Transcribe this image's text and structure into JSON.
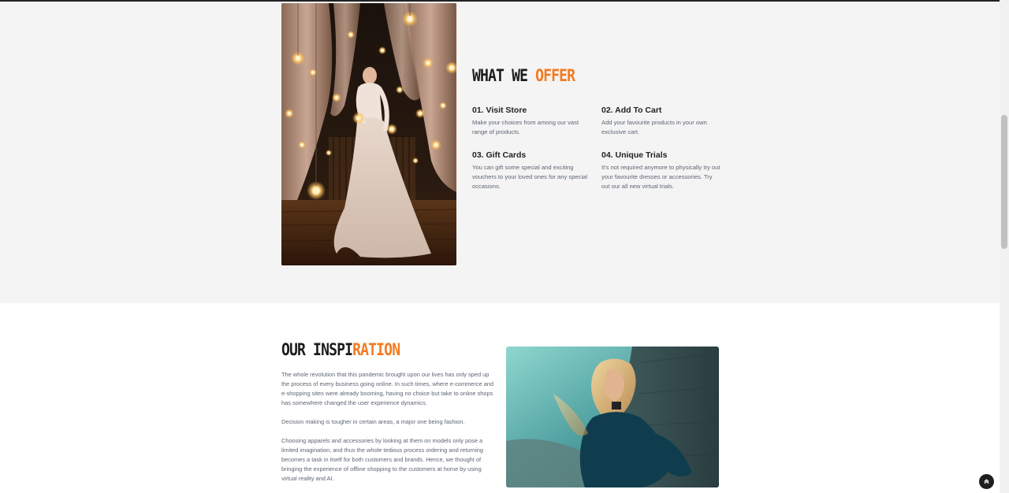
{
  "offer": {
    "title_main": "WHAT WE ",
    "title_accent": "OFFER",
    "items": [
      {
        "title": "01. Visit Store",
        "text": "Make your choices from among our vast range of products."
      },
      {
        "title": "02. Add To Cart",
        "text": "Add your favourite products in your own exclusive cart."
      },
      {
        "title": "03. Gift Cards",
        "text": "You can gift some special and exciting vouchers to your loved ones for any special occasions."
      },
      {
        "title": "04. Unique Trials",
        "text": "It's not required anymore to physically try out your favourite dresses or accessories. Try out our all new virtual trials."
      }
    ]
  },
  "inspiration": {
    "title_main": "OUR INSPI",
    "title_accent": "RATION",
    "paragraphs": [
      "The whole revolution that this pandemic brought upon our lives has only sped up the process of every business going online. In such times, where e-commerce and e-shopping sites were already booming, having no choice but take to online shops has somewhere changed the user experience dynamics.",
      "Decision making is tougher in certain areas, a major one being fashion.",
      "Choosing apparels and accessories by looking at them on models only pose a limited imagination, and thus the whole tedious process ordering and returning becomes a task in itself for both customers and brands. Hence, we thought of bringing the experience of offline shopping to the customers at home by using virtual reality and AI."
    ]
  },
  "colors": {
    "accent": "#f37a22",
    "heading": "#1c1c1c",
    "body_text": "#5d6573",
    "section_bg": "#f4f4f4"
  },
  "icons": {
    "back_to_top": "chevron-up-icon"
  }
}
